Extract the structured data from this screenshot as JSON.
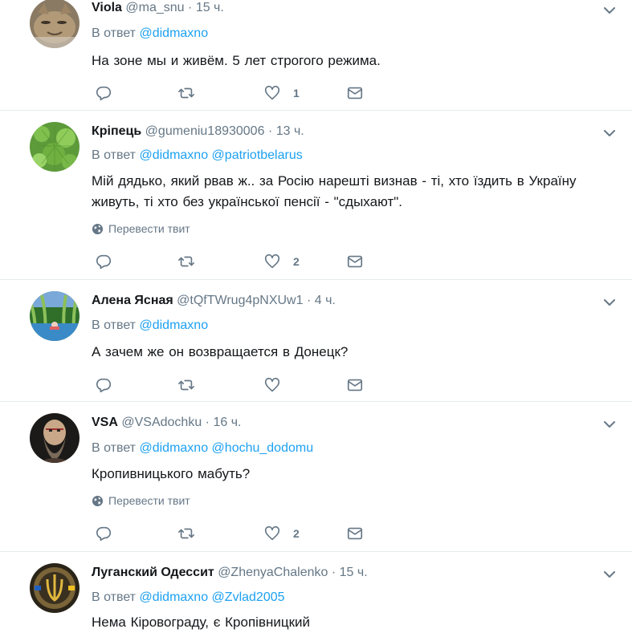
{
  "reply_prefix": "В ответ",
  "translate_label": "Перевести твит",
  "tweets": [
    {
      "fullname": "Viola",
      "handle": "@ma_snu",
      "sep": "·",
      "time": "15 ч.",
      "mentions": [
        "@didmaxno"
      ],
      "text": "На зоне мы и живём. 5 лет строгого режима.",
      "show_translate": false,
      "likes": "1",
      "avatar": "cat-photo"
    },
    {
      "fullname": "Кріпець",
      "handle": "@gumeniu18930006",
      "sep": "·",
      "time": "13 ч.",
      "mentions": [
        "@didmaxno",
        "@patriotbelarus"
      ],
      "text": "Мій дядько,  який рвав ж..  за Росію  нарешті  визнав -  ті,  хто їздить в Україну живуть,  ті хто без української пенсії  -  \"сдыхают\".",
      "show_translate": true,
      "likes": "2",
      "avatar": "dill-plant"
    },
    {
      "fullname": "Алена Ясная",
      "handle": "@tQfTWrug4pNXUw1",
      "sep": "·",
      "time": "4 ч.",
      "mentions": [
        "@didmaxno"
      ],
      "text": "А зачем же он возвращается в Донецк?",
      "show_translate": false,
      "likes": "",
      "avatar": "willow-pond"
    },
    {
      "fullname": "VSA",
      "handle": "@VSAdochku",
      "sep": "·",
      "time": "16 ч.",
      "mentions": [
        "@didmaxno",
        "@hochu_dodomu"
      ],
      "text": "Кропивницького мабуть?",
      "show_translate": true,
      "likes": "2",
      "avatar": "bearded-warrior"
    },
    {
      "fullname": "Луганский Одессит",
      "handle": "@ZhenyaChalenko",
      "sep": "·",
      "time": "15 ч.",
      "mentions": [
        "@didmaxno",
        "@Zvlad2005"
      ],
      "text": "Нема Кіровограду, є Кропівницкий",
      "show_translate": false,
      "likes": "",
      "avatar": "trident-emblem"
    }
  ],
  "colors": {
    "link": "#1da1f2",
    "muted": "#657786",
    "text": "#14171a",
    "divider": "#e6ecf0"
  }
}
